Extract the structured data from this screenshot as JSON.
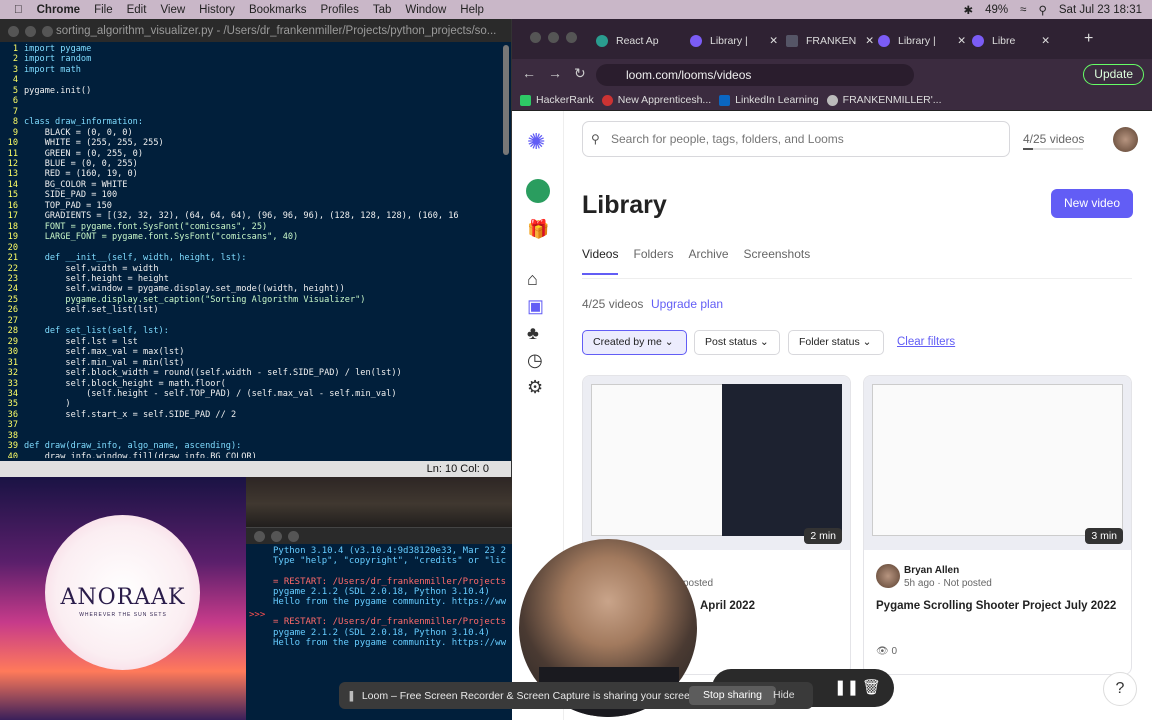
{
  "menubar": {
    "app": "Chrome",
    "items": [
      "File",
      "Edit",
      "View",
      "History",
      "Bookmarks",
      "Profiles",
      "Tab",
      "Window",
      "Help"
    ],
    "battery": "49%",
    "datetime": "Sat Jul 23  18:31"
  },
  "editor": {
    "title": "sorting_algorithm_visualizer.py - /Users/dr_frankenmiller/Projects/python_projects/so...",
    "status": "Ln: 10  Col: 0",
    "lines": [
      "import pygame",
      "import random",
      "import math",
      "",
      "pygame.init()",
      "",
      "",
      "class draw_information:",
      "    BLACK = (0, 0, 0)",
      "    WHITE = (255, 255, 255)",
      "    GREEN = (0, 255, 0)",
      "    BLUE = (0, 0, 255)",
      "    RED = (160, 19, 0)",
      "    BG_COLOR = WHITE",
      "    SIDE_PAD = 100",
      "    TOP_PAD = 150",
      "    GRADIENTS = [(32, 32, 32), (64, 64, 64), (96, 96, 96), (128, 128, 128), (160, 16",
      "    FONT = pygame.font.SysFont(\"comicsans\", 25)",
      "    LARGE_FONT = pygame.font.SysFont(\"comicsans\", 40)",
      "",
      "    def __init__(self, width, height, lst):",
      "        self.width = width",
      "        self.height = height",
      "        self.window = pygame.display.set_mode((width, height))",
      "        pygame.display.set_caption(\"Sorting Algorithm Visualizer\")",
      "        self.set_list(lst)",
      "",
      "    def set_list(self, lst):",
      "        self.lst = lst",
      "        self.max_val = max(lst)",
      "        self.min_val = min(lst)",
      "        self.block_width = round((self.width - self.SIDE_PAD) / len(lst))",
      "        self.block_height = math.floor(",
      "            (self.height - self.TOP_PAD) / (self.max_val - self.min_val)",
      "        )",
      "        self.start_x = self.SIDE_PAD // 2",
      "",
      "",
      "def draw(draw_info, algo_name, ascending):",
      "    draw_info.window.fill(draw_info.BG_COLOR)"
    ]
  },
  "shell": {
    "lines": [
      "Python 3.10.4 (v3.10.4:9d38120e33, Mar 23 2",
      "Type \"help\", \"copyright\", \"credits\" or \"lic",
      "",
      "= RESTART: /Users/dr_frankenmiller/Projects",
      "pygame 2.1.2 (SDL 2.0.18, Python 3.10.4)",
      "Hello from the pygame community. https://ww",
      "",
      "= RESTART: /Users/dr_frankenmiller/Projects",
      "pygame 2.1.2 (SDL 2.0.18, Python 3.10.4)",
      "Hello from the pygame community. https://ww"
    ],
    "prompt": ">>>"
  },
  "wallpaper": {
    "logo": "ANORAAK",
    "tagline": "WHEREVER THE SUN SETS"
  },
  "browser": {
    "tabs": [
      "React Ap",
      "Library |",
      "FRANKEN",
      "Library |",
      "Libre"
    ],
    "url": "loom.com/looms/videos",
    "update_label": "Update",
    "bookmarks": [
      "HackerRank",
      "New Apprenticesh...",
      "LinkedIn Learning",
      "FRANKENMILLER'..."
    ]
  },
  "loom": {
    "search_placeholder": "Search for people, tags, folders, and Looms",
    "count": "4/25 videos",
    "title": "Library",
    "new_video": "New video",
    "tabs": [
      "Videos",
      "Folders",
      "Archive",
      "Screenshots"
    ],
    "subcount": "4/25 videos",
    "upgrade": "Upgrade plan",
    "filters": [
      "Created by me",
      "Post status",
      "Folder status"
    ],
    "clear_filters": "Clear filters",
    "cards": [
      {
        "duration": "2 min",
        "author": "",
        "meta": "posted",
        "title": "April 2022",
        "views": "0"
      },
      {
        "duration": "3 min",
        "author": "Bryan Allen",
        "meta": "5h ago  ·  Not posted",
        "title": "Pygame Scrolling Shooter Project July 2022",
        "views": "0"
      }
    ]
  },
  "sharing": {
    "message": "Loom – Free Screen Recorder & Screen Capture is sharing your screen.",
    "stop": "Stop sharing",
    "hide": "Hide"
  },
  "help": "?",
  "colors": {
    "accent": "#625df5",
    "editor_bg": "#011f3b"
  }
}
